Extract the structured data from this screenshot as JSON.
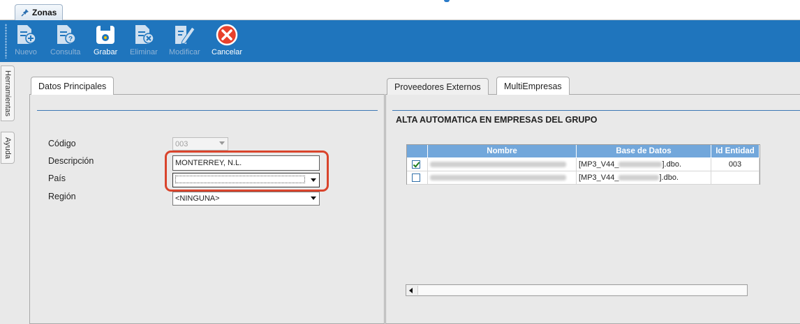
{
  "window_tab": {
    "title": "Zonas",
    "icon": "pin-icon"
  },
  "toolbar": {
    "buttons": [
      {
        "label": "Nuevo",
        "icon": "new-doc-icon",
        "enabled": false
      },
      {
        "label": "Consulta",
        "icon": "query-doc-icon",
        "enabled": false
      },
      {
        "label": "Grabar",
        "icon": "save-icon",
        "enabled": true
      },
      {
        "label": "Eliminar",
        "icon": "delete-doc-icon",
        "enabled": false
      },
      {
        "label": "Modificar",
        "icon": "edit-icon",
        "enabled": false
      },
      {
        "label": "Cancelar",
        "icon": "cancel-icon",
        "enabled": true
      }
    ]
  },
  "side_tabs": [
    "Herramientas",
    "Ayuda"
  ],
  "left_panel": {
    "tab": "Datos Principales",
    "fields": {
      "codigo": {
        "label": "Código",
        "value": "003"
      },
      "descripcion": {
        "label": "Descripción",
        "value": "MONTERREY, N.L."
      },
      "pais": {
        "label": "País",
        "value": ""
      },
      "region": {
        "label": "Región",
        "value": "<NINGUNA>"
      }
    }
  },
  "right_panel": {
    "tabs": [
      "Proveedores Externos",
      "MultiEmpresas"
    ],
    "section_title": "ALTA AUTOMATICA EN EMPRESAS DEL GRUPO",
    "grid": {
      "columns": [
        "",
        "Nombre",
        "Base de Datos",
        "Id Entidad"
      ],
      "rows": [
        {
          "checked": true,
          "base_prefix": "[MP3_V44_",
          "base_suffix": "].dbo.",
          "id_entidad": "003"
        },
        {
          "checked": false,
          "base_prefix": "[MP3_V44_",
          "base_suffix": "].dbo.",
          "id_entidad": ""
        }
      ]
    }
  },
  "colors": {
    "toolbar_bg": "#1f75bd",
    "grid_header": "#72a7db",
    "highlight": "#d9442c"
  }
}
